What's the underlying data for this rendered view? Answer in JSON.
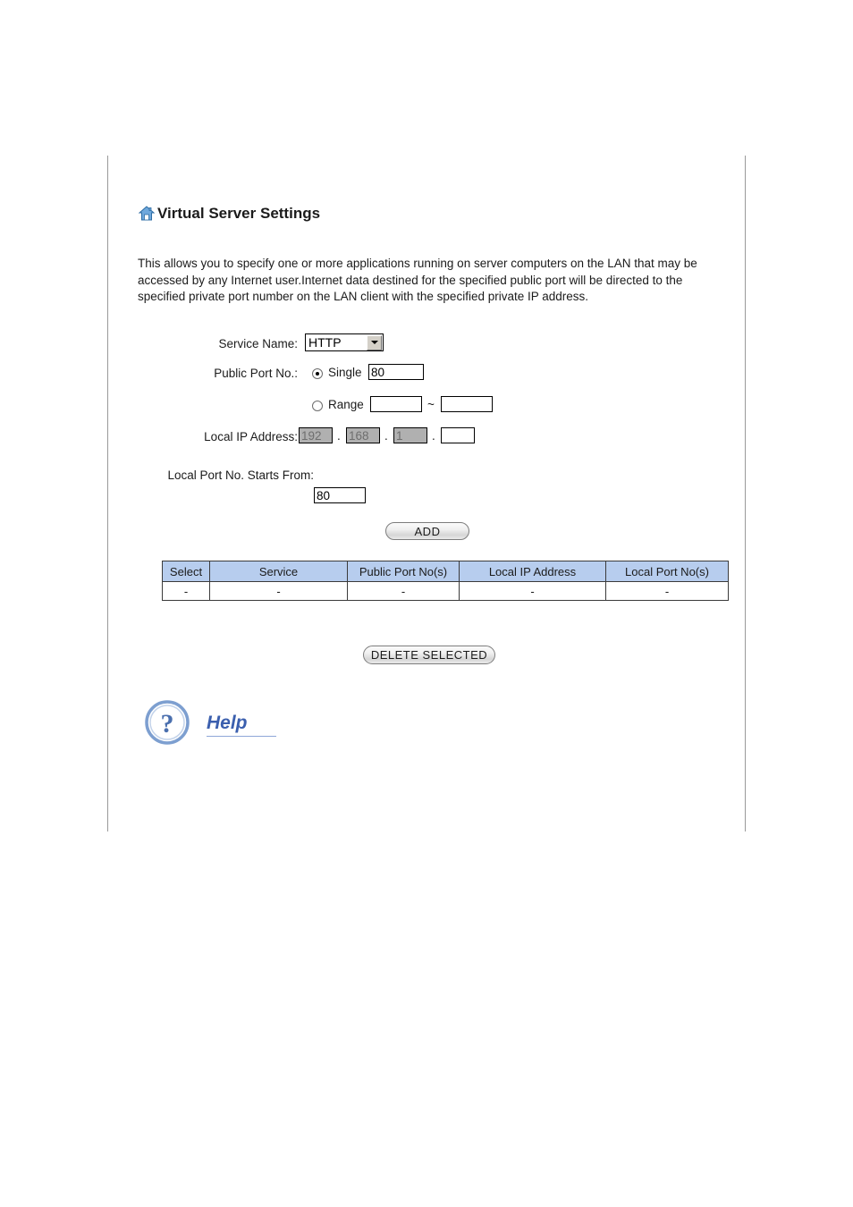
{
  "page": {
    "title": "Virtual Server Settings",
    "home_icon": "house-icon",
    "description": "This allows you to specify one or more applications running on server computers on the LAN that may be accessed by any Internet user.Internet data destined for the specified public port will be directed to the specified private port number on the LAN client with the specified private IP address."
  },
  "form": {
    "service_name_label": "Service Name:",
    "service_name_value": "HTTP",
    "service_name_options": [
      "HTTP"
    ],
    "public_port_label": "Public Port No.:",
    "single_label": "Single",
    "single_selected": true,
    "single_value": "80",
    "range_label": "Range",
    "range_selected": false,
    "range_start_value": "",
    "range_separator": "~",
    "range_end_value": "",
    "local_ip_label": "Local IP Address:",
    "local_ip_octet1": "192",
    "local_ip_octet2": "168",
    "local_ip_octet3": "1",
    "local_ip_octet4": "",
    "local_ip_dot": ".",
    "local_port_label": "Local Port No. Starts From:",
    "local_port_value": "80"
  },
  "buttons": {
    "add": "ADD",
    "delete_selected": "DELETE SELECTED"
  },
  "table": {
    "headers": [
      "Select",
      "Service",
      "Public Port No(s)",
      "Local IP Address",
      "Local Port No(s)"
    ],
    "rows": [
      [
        "-",
        "-",
        "-",
        "-",
        "-"
      ]
    ]
  },
  "help": {
    "label": "Help",
    "icon": "question-mark-icon"
  },
  "colors": {
    "header_bg": "#b7cdee",
    "help_text": "#3b5fae",
    "disabled_field": "#b0b0b0"
  }
}
